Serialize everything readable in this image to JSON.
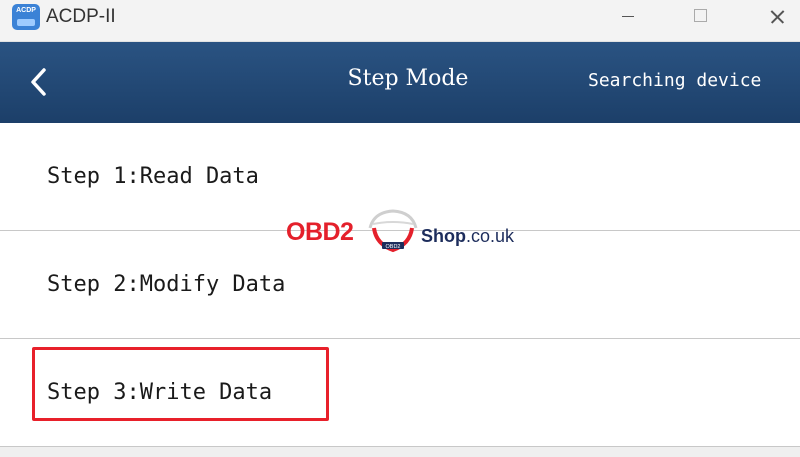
{
  "window": {
    "title": "ACDP-II",
    "logo_text": "ACDP"
  },
  "header": {
    "title": "Step Mode",
    "status": "Searching device"
  },
  "steps": [
    {
      "label": "Step 1:Read Data",
      "highlighted": false
    },
    {
      "label": "Step 2:Modify Data",
      "highlighted": false
    },
    {
      "label": "Step 3:Write Data",
      "highlighted": true
    }
  ],
  "watermark": {
    "brand": "OBD2",
    "shop": "Shop",
    "tld": ".co.uk",
    "badge": "OBD2"
  },
  "colors": {
    "header_bg": "#1f4470",
    "highlight_border": "#e8202a",
    "watermark_red": "#e4202b",
    "watermark_navy": "#1d2d5c"
  },
  "icons": {
    "back": "chevron-left-icon",
    "minimize": "minimize-icon",
    "maximize": "maximize-icon",
    "close": "close-icon"
  }
}
